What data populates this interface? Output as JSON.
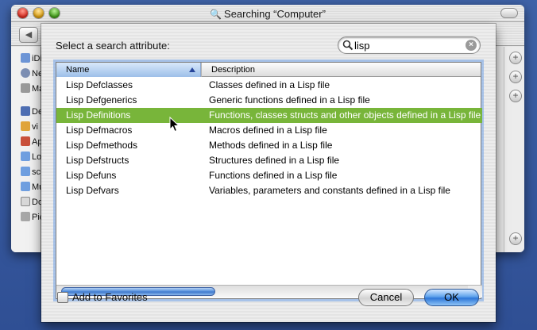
{
  "background_window": {
    "title": "Searching “Computer”",
    "sidebar_items": [
      "iDisk",
      "Network",
      "Mac",
      "Desktop",
      "vi",
      "Applications",
      "Local",
      "sc",
      "Music",
      "Documents",
      "Pictures"
    ]
  },
  "sheet": {
    "prompt": "Select a search attribute:",
    "search_value": "lisp",
    "columns": {
      "name": "Name",
      "description": "Description"
    },
    "rows": [
      {
        "name": "Lisp Defclasses",
        "description": "Classes defined in a Lisp file"
      },
      {
        "name": "Lisp Defgenerics",
        "description": "Generic functions defined in a Lisp file"
      },
      {
        "name": "Lisp Definitions",
        "description": "Functions, classes structs and other objects defined in a Lisp file"
      },
      {
        "name": "Lisp Defmacros",
        "description": "Macros defined in a Lisp file"
      },
      {
        "name": "Lisp Defmethods",
        "description": "Methods defined in a Lisp file"
      },
      {
        "name": "Lisp Defstructs",
        "description": "Structures defined in a Lisp file"
      },
      {
        "name": "Lisp Defuns",
        "description": "Functions defined in a Lisp file"
      },
      {
        "name": "Lisp Defvars",
        "description": "Variables, parameters and constants defined in a Lisp file"
      }
    ],
    "selected_row": 2,
    "add_to_favorites_label": "Add to Favorites",
    "add_to_favorites_checked": false,
    "cancel_label": "Cancel",
    "ok_label": "OK",
    "colors": {
      "selection": "#78b53a",
      "accent": "#3f79cd"
    },
    "icons": {
      "search": "magnifier-icon",
      "clear": "clear-icon",
      "sort": "sort-ascending-icon"
    }
  }
}
